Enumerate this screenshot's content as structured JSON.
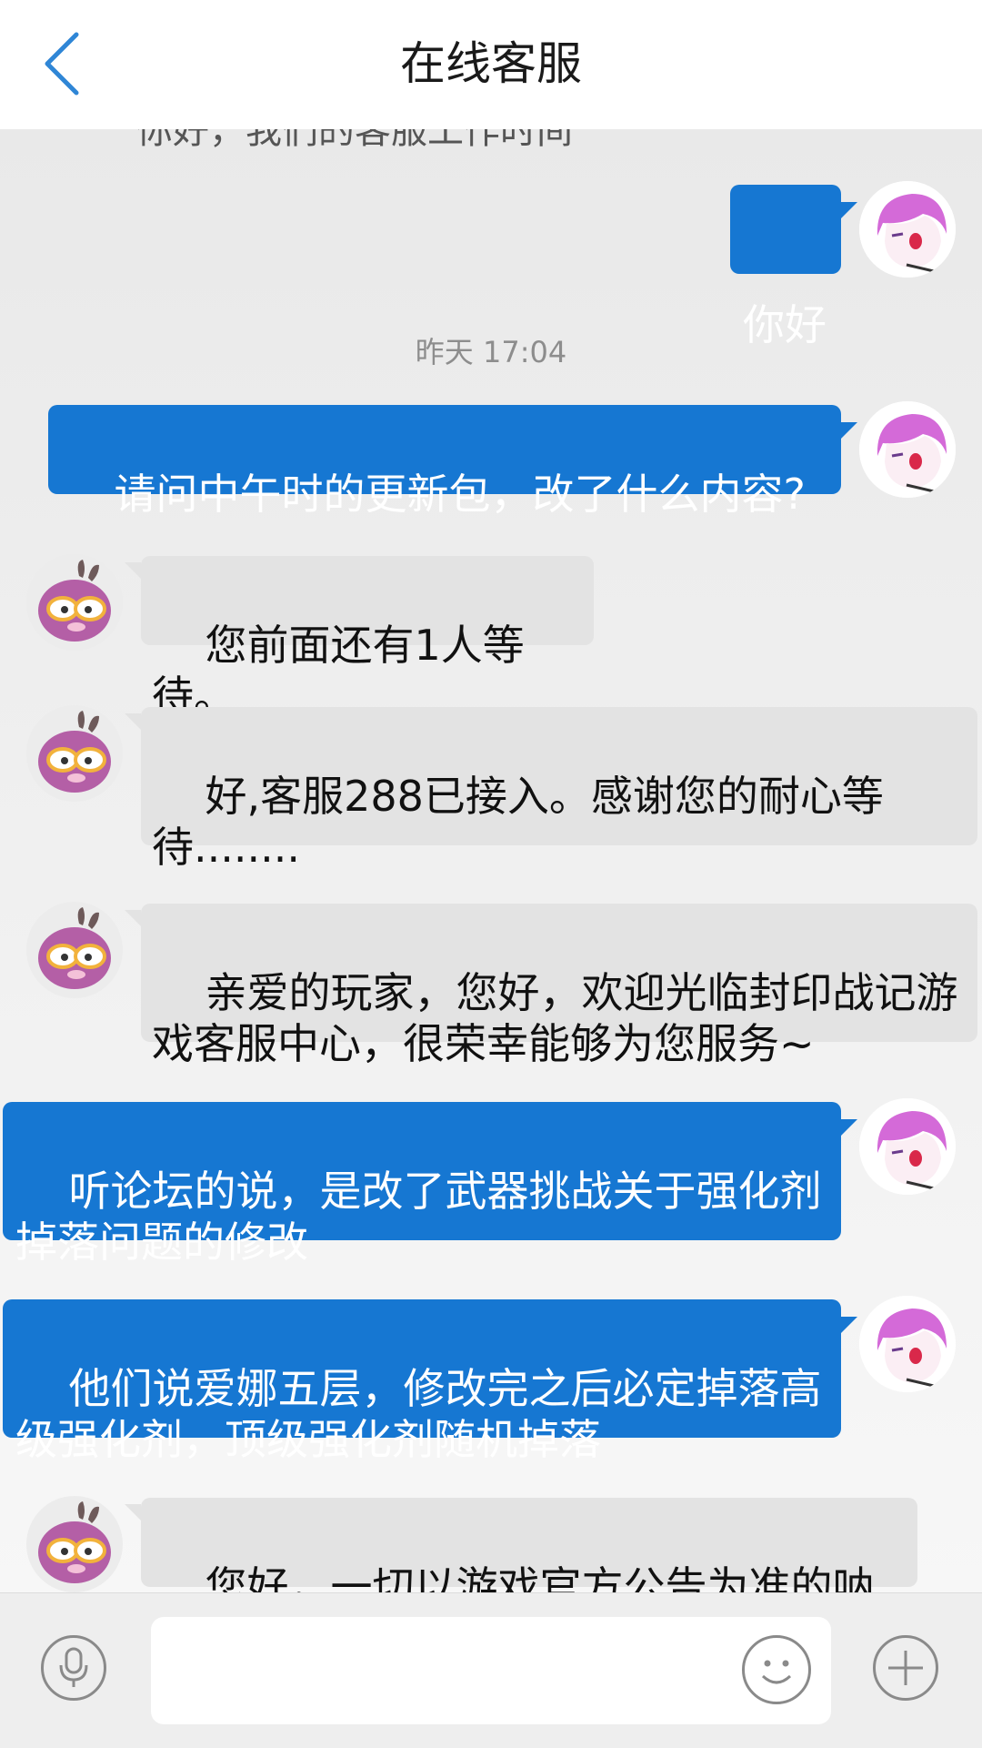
{
  "header": {
    "title": "在线客服",
    "back_icon": "chevron-left-icon",
    "accent": "#2f86d6"
  },
  "chat": {
    "partial_top_text": "你好，我们的客服工作时间",
    "messages": [
      {
        "sender": "user",
        "text": "你好"
      },
      {
        "type": "timestamp",
        "text": "昨天 17:04"
      },
      {
        "sender": "user",
        "text": "请问中午时的更新包，改了什么内容?"
      },
      {
        "sender": "cs",
        "text": "您前面还有1人等待。"
      },
      {
        "sender": "cs",
        "text": "好,客服288已接入。感谢您的耐心等\n待........"
      },
      {
        "sender": "cs",
        "text": "亲爱的玩家，您好，欢迎光临封印战记游\n戏客服中心，很荣幸能够为您服务~"
      },
      {
        "sender": "user",
        "text": "听论坛的说，是改了武器挑战关于强化剂\n掉落问题的修改"
      },
      {
        "sender": "user",
        "text": "他们说爱娜五层，修改完之后必定掉落高\n级强化剂，顶级强化剂随机掉落"
      },
      {
        "sender": "cs",
        "text": "您好，一切以游戏官方公告为准的呐~"
      }
    ]
  },
  "input_bar": {
    "placeholder": "",
    "voice_icon": "microphone-icon",
    "emoji_icon": "smiley-icon",
    "add_icon": "plus-icon"
  },
  "colors": {
    "user_bubble": "#1677d2",
    "cs_bubble": "#e3e3e3",
    "background": "#ededed"
  }
}
